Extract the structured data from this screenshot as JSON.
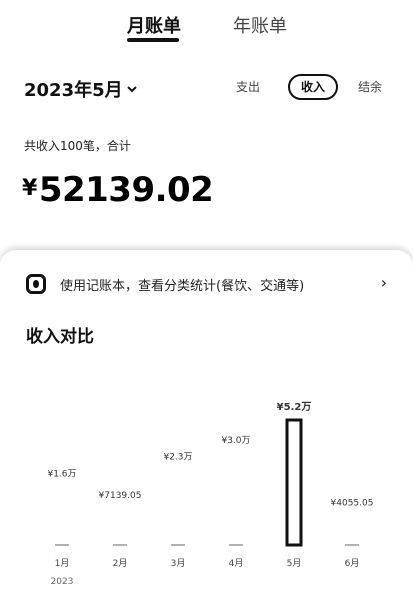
{
  "tabs": {
    "monthly": "月账单",
    "yearly": "年账单"
  },
  "period": {
    "label": "2023年5月"
  },
  "filters": {
    "expense": "支出",
    "income": "收入",
    "balance": "结余"
  },
  "summary": {
    "text": "共收入100笔，合计"
  },
  "total": {
    "currency": "¥",
    "value": "52139.02"
  },
  "promo": {
    "text": "使用记账本，查看分类统计(餐饮、交通等)",
    "arrow": "›"
  },
  "section": {
    "title": "收入对比"
  },
  "chart_data": {
    "type": "bar",
    "categories": [
      "1月",
      "2月",
      "3月",
      "4月",
      "5月",
      "6月"
    ],
    "sublabels": [
      "2023",
      "",
      "",
      "",
      "",
      ""
    ],
    "values": [
      16000,
      7139.05,
      23000,
      30000,
      52000,
      4055.05
    ],
    "value_labels": [
      "¥1.6万",
      "¥7139.05",
      "¥2.3万",
      "¥3.0万",
      "¥5.2万",
      "¥4055.05"
    ],
    "highlight_index": 4,
    "ylim": [
      0,
      52000
    ]
  }
}
